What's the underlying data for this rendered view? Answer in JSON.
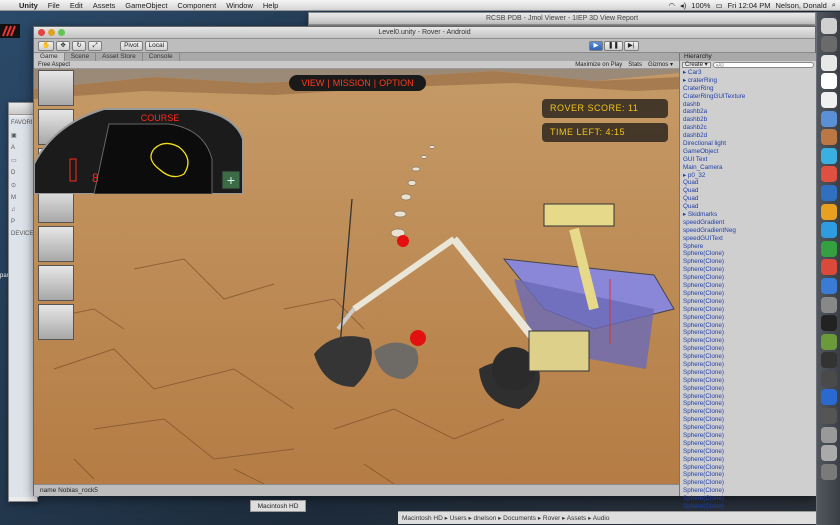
{
  "menubar": {
    "app": "Unity",
    "items": [
      "File",
      "Edit",
      "Assets",
      "GameObject",
      "Component",
      "Window",
      "Help"
    ],
    "battery": "100%",
    "clock": "Fri 12:04 PM",
    "user": "Nelson, Donald"
  },
  "jmol_title": "RCSB PDB - Jmol Viewer - 1IEP 3D View Report",
  "unity": {
    "title": "Level0.unity - Rover - Android",
    "toolbar": {
      "pivot": "Pivot",
      "local": "Local",
      "play": "▶",
      "pause": "❚❚",
      "step": "▶|"
    },
    "tabs": [
      "Game",
      "Scene",
      "Asset Store",
      "Console"
    ],
    "game_bar": {
      "aspect": "Free Aspect",
      "maximize": "Maximize on Play",
      "stats": "Stats",
      "gizmos": "Gizmos ▾"
    },
    "hud": {
      "menu": [
        "VIEW",
        "MISSION",
        "OPTION"
      ],
      "score": "ROVER SCORE: 11",
      "time": "TIME LEFT: 4:15",
      "course": "COURSE",
      "speed": "8"
    },
    "status": "name Nobias_rock5",
    "hierarchy": {
      "header": "Hierarchy",
      "create": "Create ▾",
      "search": "▾All",
      "items": [
        "▸ Car3",
        "▸ craterRing",
        "CraterRing",
        "CraterRingGUITexture",
        "dashb",
        "dashb2a",
        "dashb2b",
        "dashb2c",
        "dashb2d",
        "Directional light",
        "GameObject",
        "GUI Text",
        "Main_Camera",
        "▸ p0_32",
        "Quad",
        "Quad",
        "Quad",
        "Quad",
        "▸ Skidmarks",
        "speedGradient",
        "speedGradientNeg",
        "speedGUIText",
        "Sphere",
        "Sphere(Clone)",
        "Sphere(Clone)",
        "Sphere(Clone)",
        "Sphere(Clone)",
        "Sphere(Clone)",
        "Sphere(Clone)",
        "Sphere(Clone)",
        "Sphere(Clone)",
        "Sphere(Clone)",
        "Sphere(Clone)",
        "Sphere(Clone)",
        "Sphere(Clone)",
        "Sphere(Clone)",
        "Sphere(Clone)",
        "Sphere(Clone)",
        "Sphere(Clone)",
        "Sphere(Clone)",
        "Sphere(Clone)",
        "Sphere(Clone)",
        "Sphere(Clone)",
        "Sphere(Clone)",
        "Sphere(Clone)",
        "Sphere(Clone)",
        "Sphere(Clone)",
        "Sphere(Clone)",
        "Sphere(Clone)",
        "Sphere(Clone)",
        "Sphere(Clone)",
        "Sphere(Clone)",
        "Sphere(Clone)",
        "Sphere(Clone)",
        "Sphere(Clone)",
        "Sphere(Clone)",
        "Sphere(Clone)"
      ]
    }
  },
  "finder": {
    "favorites": "FAVORI",
    "devices": "DEVICE"
  },
  "desktop_label": "para",
  "mhd": "Macintosh HD",
  "pathbar": "Macintosh HD ▸ Users ▸ dnelson ▸ Documents ▸ Rover ▸ Assets ▸ Audio",
  "colors": {
    "hud_text": "#f2c31c",
    "menu_text": "#ff3b1e",
    "course_text": "#ff2a1a"
  }
}
